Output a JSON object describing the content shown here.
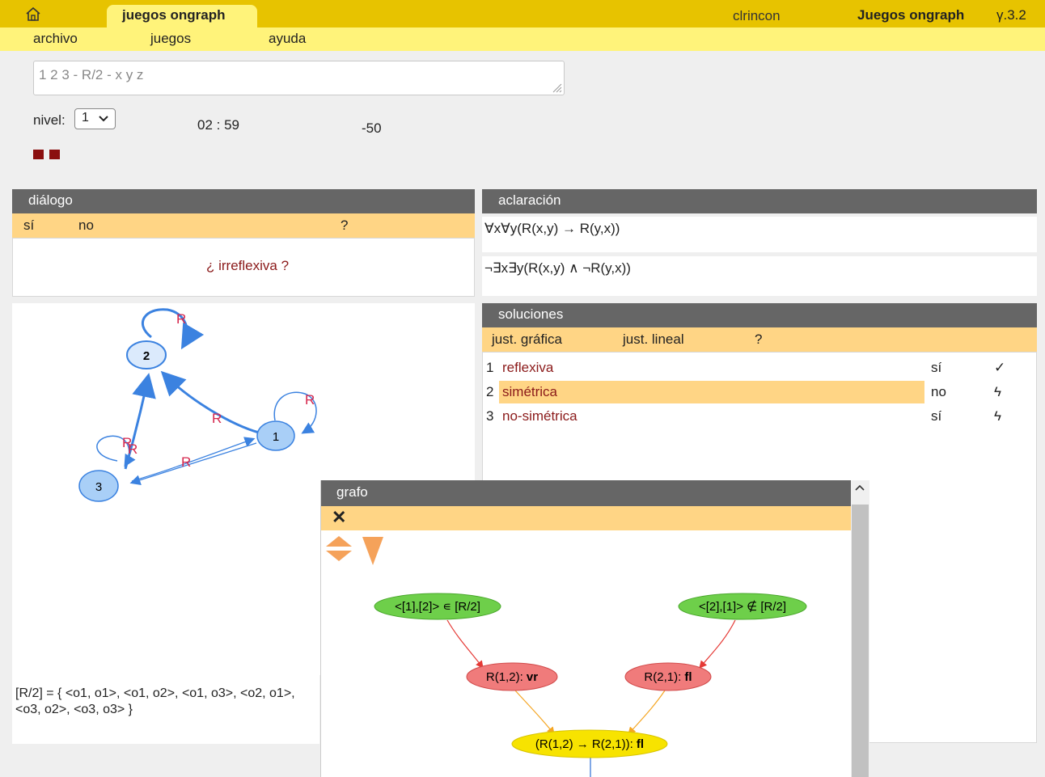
{
  "topbar": {
    "tab_label": "juegos ongraph",
    "user": "clrincon",
    "app_name": "Juegos ongraph",
    "version": "γ.3.2"
  },
  "menu": [
    "archivo",
    "juegos",
    "ayuda"
  ],
  "query": {
    "value": "1 2 3 - R/2 - x y z"
  },
  "nivel": {
    "label": "nivel:",
    "value": "1"
  },
  "timer": "02 : 59",
  "score": "-50",
  "dialogo": {
    "title": "diálogo",
    "options": [
      "sí",
      "no",
      "?"
    ],
    "question": "¿ irreflexiva ?"
  },
  "aclaracion": {
    "title": "aclaración",
    "formulas": [
      "∀x∀y(R(x,y) → R(y,x))",
      "¬∃x∃y(R(x,y) ∧ ¬R(y,x))"
    ]
  },
  "soluciones": {
    "title": "soluciones",
    "options": [
      "just. gráfica",
      "just. lineal",
      "?"
    ],
    "rows": [
      {
        "num": "1",
        "name": "reflexiva",
        "value": "sí",
        "mark": "✓",
        "highlighted": false
      },
      {
        "num": "2",
        "name": "simétrica",
        "value": "no",
        "mark": "ϟ",
        "highlighted": true
      },
      {
        "num": "3",
        "name": "no-simétrica",
        "value": "sí",
        "mark": "ϟ",
        "highlighted": false
      }
    ]
  },
  "graph": {
    "nodes": [
      "1",
      "2",
      "3"
    ],
    "edge_label": "R",
    "extension": "[R/2] = { <o1, o1>, <o1, o2>, <o1, o3>, <o2, o1>, <o3, o2>, <o3, o3> }"
  },
  "modal": {
    "title": "grafo",
    "close": "✕",
    "nodes": {
      "premise_left": "<[1],[2]> ∊ [R/2]",
      "premise_right": "<[2],[1]> ∉ [R/2]",
      "r12": "R(1,2): ",
      "r12_val": "vr",
      "r21": "R(2,1): ",
      "r21_val": "fl",
      "impl": "(R(1,2) → R(2,1)): ",
      "impl_val": "fl"
    }
  },
  "colors": {
    "topbar": "#e7c300",
    "menubar": "#fff37a",
    "panel_head": "#666666",
    "panel_sub": "#ffd585",
    "node_blue": "#a9cff7",
    "edge_blue": "#3b82e0",
    "label_red": "#d6264c",
    "green_node": "#6ecf4a",
    "red_node": "#f07b7b",
    "yellow_node": "#f7e300"
  }
}
